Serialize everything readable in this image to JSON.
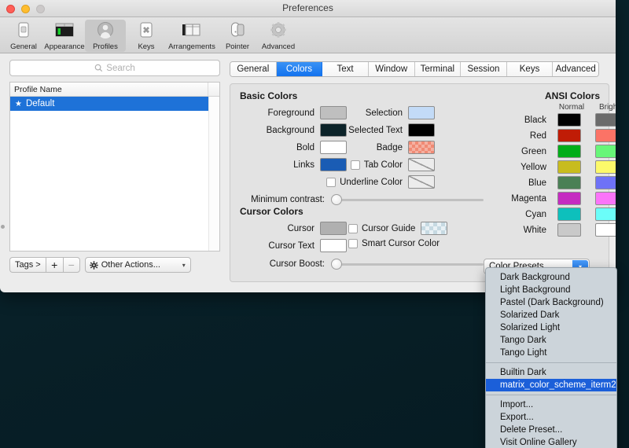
{
  "window": {
    "title": "Preferences",
    "traffic_lights": [
      "close-red",
      "minimize-yellow",
      "zoom-disabled"
    ]
  },
  "toolbar": {
    "items": [
      {
        "label": "General",
        "icon": "general-icon",
        "selected": false
      },
      {
        "label": "Appearance",
        "icon": "appearance-icon",
        "selected": false
      },
      {
        "label": "Profiles",
        "icon": "profiles-icon",
        "selected": true
      },
      {
        "label": "Keys",
        "icon": "keys-icon",
        "selected": false
      },
      {
        "label": "Arrangements",
        "icon": "arrangements-icon",
        "selected": false
      },
      {
        "label": "Pointer",
        "icon": "pointer-icon",
        "selected": false
      },
      {
        "label": "Advanced",
        "icon": "advanced-icon",
        "selected": false
      }
    ]
  },
  "sidebar": {
    "search": {
      "placeholder": "Search",
      "value": "",
      "icon": "search-icon"
    },
    "table": {
      "column_header": "Profile Name"
    },
    "profiles": [
      {
        "name": "Default",
        "starred": true,
        "star_glyph": "★",
        "selected": true
      }
    ],
    "bottom_bar": {
      "tags_label": "Tags >",
      "add_label": "+",
      "remove_label": "−",
      "other_actions_label": "Other Actions...",
      "other_actions_icon": "gear-icon",
      "caret": "▾"
    }
  },
  "tabs": [
    {
      "label": "General",
      "active": false
    },
    {
      "label": "Colors",
      "active": true
    },
    {
      "label": "Text",
      "active": false
    },
    {
      "label": "Window",
      "active": false
    },
    {
      "label": "Terminal",
      "active": false
    },
    {
      "label": "Session",
      "active": false
    },
    {
      "label": "Keys",
      "active": false
    },
    {
      "label": "Advanced",
      "active": false
    }
  ],
  "colors_tab": {
    "basic_colors": {
      "title": "Basic Colors",
      "left": [
        {
          "label": "Foreground",
          "color": "#bfbfbf"
        },
        {
          "label": "Background",
          "color": "#0c2329"
        },
        {
          "label": "Bold",
          "color": "#ffffff"
        },
        {
          "label": "Links",
          "color": "#1a5cb4"
        }
      ],
      "right": [
        {
          "label": "Selection",
          "color": "#c3dbf7",
          "checkbox": false
        },
        {
          "label": "Selected Text",
          "color": "#000000",
          "checkbox": false
        },
        {
          "label": "Badge",
          "color": "#f08a74",
          "checkbox": false,
          "pattern": "checkered"
        },
        {
          "label": "Tab Color",
          "color": "",
          "checkbox": true,
          "checked": false,
          "disabled": true
        },
        {
          "label": "Underline Color",
          "color": "",
          "checkbox": true,
          "checked": false,
          "disabled": true
        }
      ],
      "minimum_contrast": {
        "label": "Minimum contrast:",
        "value": 0
      }
    },
    "cursor_colors": {
      "title": "Cursor Colors",
      "left": [
        {
          "label": "Cursor",
          "color": "#b0b0b0"
        },
        {
          "label": "Cursor Text",
          "color": "#ffffff"
        }
      ],
      "right": [
        {
          "label": "Cursor Guide",
          "color": "#dbe8ef",
          "checkbox": true,
          "checked": false,
          "pattern": "checkered"
        },
        {
          "label": "Smart Cursor Color",
          "color": "",
          "checkbox": true,
          "checked": false,
          "swatch": false
        }
      ],
      "cursor_boost": {
        "label": "Cursor Boost:",
        "value": 0
      }
    },
    "ansi_colors": {
      "title": "ANSI Colors",
      "headers": [
        "Normal",
        "Bright"
      ],
      "rows": [
        {
          "name": "Black",
          "normal": "#000000",
          "bright": "#6b6b6b"
        },
        {
          "name": "Red",
          "normal": "#c01c06",
          "bright": "#fb7366"
        },
        {
          "name": "Green",
          "normal": "#00ad18",
          "bright": "#67f678"
        },
        {
          "name": "Yellow",
          "normal": "#c8bc1e",
          "bright": "#fcf96a"
        },
        {
          "name": "Blue",
          "normal": "#4a8055",
          "bright": "#6e72f7"
        },
        {
          "name": "Magenta",
          "normal": "#c52bc1",
          "bright": "#fb74f9"
        },
        {
          "name": "Cyan",
          "normal": "#0dc0bc",
          "bright": "#6bfdf9"
        },
        {
          "name": "White",
          "normal": "#c9c9c9",
          "bright": "#ffffff"
        }
      ]
    },
    "color_presets_button": {
      "label": "Color Presets...",
      "arrow": "▾"
    }
  },
  "presets_menu": {
    "groups": [
      [
        {
          "label": "Dark Background",
          "selected": false
        },
        {
          "label": "Light Background",
          "selected": false
        },
        {
          "label": "Pastel (Dark Background)",
          "selected": false
        },
        {
          "label": "Solarized Dark",
          "selected": false
        },
        {
          "label": "Solarized Light",
          "selected": false
        },
        {
          "label": "Tango Dark",
          "selected": false
        },
        {
          "label": "Tango Light",
          "selected": false
        }
      ],
      [
        {
          "label": "Builtin Dark",
          "selected": false
        },
        {
          "label": "matrix_color_scheme_iterm2",
          "selected": true
        }
      ],
      [
        {
          "label": "Import...",
          "selected": false
        },
        {
          "label": "Export...",
          "selected": false
        },
        {
          "label": "Delete Preset...",
          "selected": false
        },
        {
          "label": "Visit Online Gallery",
          "selected": false
        }
      ]
    ]
  },
  "desktop": {
    "background_color": "#0a2630"
  }
}
